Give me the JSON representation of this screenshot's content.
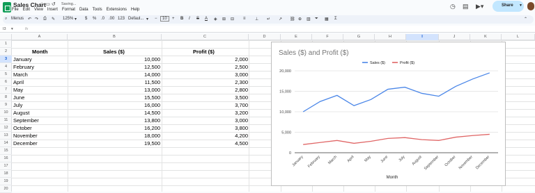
{
  "app": {
    "doc_title": "Sales Chart",
    "saving_text": "Saving...",
    "menu": [
      "File",
      "Edit",
      "View",
      "Insert",
      "Format",
      "Data",
      "Tools",
      "Extensions",
      "Help"
    ],
    "share_label": "Share"
  },
  "toolbar": {
    "menus_label": "Menus",
    "zoom": "125%",
    "currency": "$",
    "percent": "%",
    "dec_less": ".0",
    "dec_more": ".00",
    "number_format": "123",
    "font": "Defaul...",
    "font_size": "10",
    "bold": "B",
    "italic": "I",
    "text_color": "A"
  },
  "formula_bar": {
    "cell_ref": "I3",
    "fx": "fx",
    "value": ""
  },
  "sheet": {
    "columns": [
      "A",
      "B",
      "C",
      "D",
      "E",
      "F",
      "G",
      "H",
      "I",
      "J",
      "K",
      "L"
    ],
    "selected_column": "I",
    "rows": [
      "1",
      "2",
      "3",
      "4",
      "5",
      "6",
      "7",
      "8",
      "9",
      "10",
      "11",
      "12",
      "13",
      "14",
      "15",
      "16",
      "17",
      "18",
      "19",
      "20"
    ],
    "selected_row": "3",
    "headers": {
      "month": "Month",
      "sales": "Sales ($)",
      "profit": "Profit ($)"
    },
    "data": [
      {
        "month": "January",
        "sales": "10,000",
        "profit": "2,000"
      },
      {
        "month": "February",
        "sales": "12,500",
        "profit": "2,500"
      },
      {
        "month": "March",
        "sales": "14,000",
        "profit": "3,000"
      },
      {
        "month": "April",
        "sales": "11,500",
        "profit": "2,300"
      },
      {
        "month": "May",
        "sales": "13,000",
        "profit": "2,800"
      },
      {
        "month": "June",
        "sales": "15,500",
        "profit": "3,500"
      },
      {
        "month": "July",
        "sales": "16,000",
        "profit": "3,700"
      },
      {
        "month": "August",
        "sales": "14,500",
        "profit": "3,200"
      },
      {
        "month": "September",
        "sales": "13,800",
        "profit": "3,000"
      },
      {
        "month": "October",
        "sales": "16,200",
        "profit": "3,800"
      },
      {
        "month": "November",
        "sales": "18,000",
        "profit": "4,200"
      },
      {
        "month": "December",
        "sales": "19,500",
        "profit": "4,500"
      }
    ]
  },
  "chart_data": {
    "type": "line",
    "title": "Sales ($) and Profit ($)",
    "xlabel": "Month",
    "ylabel": "",
    "categories": [
      "January",
      "February",
      "March",
      "April",
      "May",
      "June",
      "July",
      "August",
      "September",
      "October",
      "November",
      "December"
    ],
    "series": [
      {
        "name": "Sales ($)",
        "color": "#4a86e8",
        "values": [
          10000,
          12500,
          14000,
          11500,
          13000,
          15500,
          16000,
          14500,
          13800,
          16200,
          18000,
          19500
        ]
      },
      {
        "name": "Profit ($)",
        "color": "#e06666",
        "values": [
          2000,
          2500,
          3000,
          2300,
          2800,
          3500,
          3700,
          3200,
          3000,
          3800,
          4200,
          4500
        ]
      }
    ],
    "ylim": [
      0,
      20000
    ],
    "yticks": [
      "0",
      "5,000",
      "10,000",
      "15,000",
      "20,000"
    ],
    "legend": "top-center",
    "grid": true
  }
}
